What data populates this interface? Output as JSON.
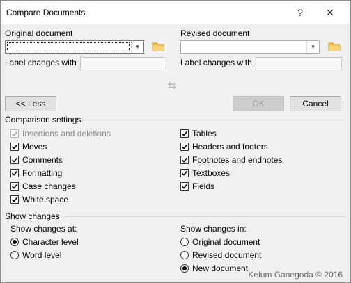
{
  "window": {
    "title": "Compare Documents",
    "help_label": "?",
    "close_label": "✕"
  },
  "original": {
    "label": "Original document",
    "value": "",
    "label_changes_label": "Label changes with",
    "label_changes_value": ""
  },
  "revised": {
    "label": "Revised document",
    "value": "",
    "label_changes_label": "Label changes with",
    "label_changes_value": ""
  },
  "swap_icon": "⇆",
  "buttons": {
    "less": "<< Less",
    "ok": "OK",
    "cancel": "Cancel"
  },
  "comparison_settings": {
    "heading": "Comparison settings",
    "left": [
      {
        "label": "Insertions and deletions",
        "checked": true,
        "disabled": true
      },
      {
        "label": "Moves",
        "checked": true,
        "disabled": false
      },
      {
        "label": "Comments",
        "checked": true,
        "disabled": false
      },
      {
        "label": "Formatting",
        "checked": true,
        "disabled": false
      },
      {
        "label": "Case changes",
        "checked": true,
        "disabled": false
      },
      {
        "label": "White space",
        "checked": true,
        "disabled": false
      }
    ],
    "right": [
      {
        "label": "Tables",
        "checked": true,
        "disabled": false
      },
      {
        "label": "Headers and footers",
        "checked": true,
        "disabled": false
      },
      {
        "label": "Footnotes and endnotes",
        "checked": true,
        "disabled": false
      },
      {
        "label": "Textboxes",
        "checked": true,
        "disabled": false
      },
      {
        "label": "Fields",
        "checked": true,
        "disabled": false
      }
    ]
  },
  "show_changes": {
    "heading": "Show changes",
    "at_label": "Show changes at:",
    "at_options": [
      {
        "label": "Character level",
        "selected": true
      },
      {
        "label": "Word level",
        "selected": false
      }
    ],
    "in_label": "Show changes in:",
    "in_options": [
      {
        "label": "Original document",
        "selected": false
      },
      {
        "label": "Revised document",
        "selected": false
      },
      {
        "label": "New document",
        "selected": true
      }
    ]
  },
  "watermark": "Kelum Ganegoda © 2016",
  "colors": {
    "dialog_bg": "#f0f0f0",
    "titlebar_bg": "#ffffff",
    "disabled_text": "#8a8a8a"
  }
}
